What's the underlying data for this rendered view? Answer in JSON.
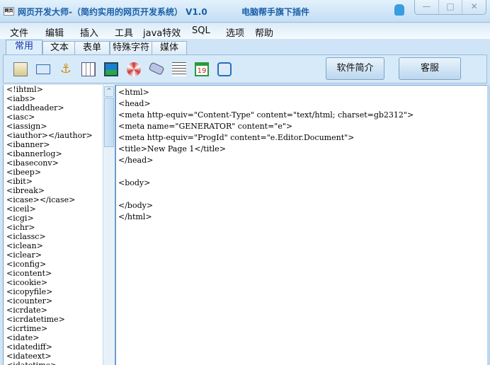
{
  "window": {
    "app_icon_text": "网页",
    "title": "网页开发大师-（简约实用的网页开发系统） V1.0",
    "subtitle": "电脑帮手旗下插件",
    "controls": [
      "—",
      "□",
      "✕"
    ]
  },
  "menu": [
    "文件",
    "编辑",
    "插入",
    "工具",
    "java特效",
    "SQL",
    "选项",
    "帮助"
  ],
  "tabs": [
    {
      "label": "常用",
      "active": true
    },
    {
      "label": "文本"
    },
    {
      "label": "表单"
    },
    {
      "label": "特殊字符"
    },
    {
      "label": "媒体"
    }
  ],
  "toolbar": {
    "icons": [
      "html-page-icon",
      "email-icon",
      "anchor-icon",
      "table-icon",
      "image-icon",
      "flash-icon",
      "scroll-icon",
      "horizontal-rule-icon",
      "calendar-icon",
      "comment-icon"
    ],
    "calendar_number": "19",
    "intro_button": "软件简介",
    "service_button": "客服"
  },
  "tag_list": [
    "<!ihtml>",
    "<iabs>",
    "<iaddheader>",
    "<iasc>",
    "<iassign>",
    "<iauthor></iauthor>",
    "<ibanner>",
    "<ibannerlog>",
    "<ibaseconv>",
    "<ibeep>",
    "<ibit>",
    "<ibreak>",
    "<icase></icase>",
    "<iceil>",
    "<icgi>",
    "<ichr>",
    "<iclassc>",
    "<iclean>",
    "<iclear>",
    "<iconfig>",
    "<icontent>",
    "<icookie>",
    "<icopyfile>",
    "<icounter>",
    "<icrdate>",
    "<icrdatetime>",
    "<icrtime>",
    "<idate>",
    "<idatediff>",
    "<idateext>",
    "<idatetime>"
  ],
  "editor_lines": [
    "<html>",
    "<head>",
    "<meta http-equiv=\"Content-Type\" content=\"text/html; charset=gb2312\">",
    "<meta name=\"GENERATOR\" content=\"e\">",
    "<meta http-equiv=\"ProgId\" content=\"e.Editor.Document\">",
    "<title>New Page 1</title>",
    "</head>",
    "",
    "<body>",
    "",
    "</body>",
    "</html>"
  ],
  "scroll_up": "^"
}
